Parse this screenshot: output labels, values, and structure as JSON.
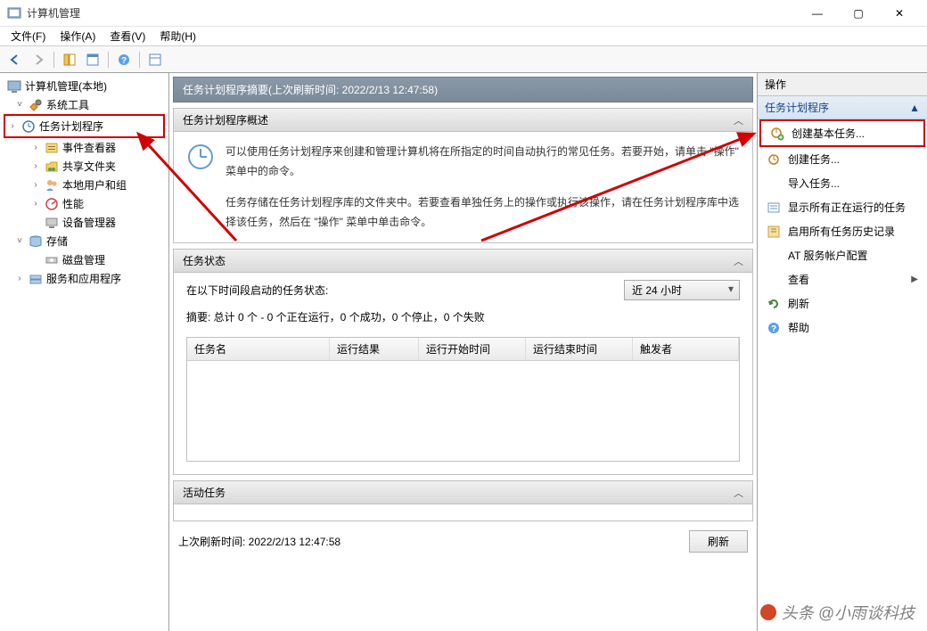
{
  "window": {
    "title": "计算机管理",
    "controls": {
      "min": "—",
      "max": "▢",
      "close": "✕"
    }
  },
  "menu": {
    "file": "文件(F)",
    "action": "操作(A)",
    "view": "查看(V)",
    "help": "帮助(H)"
  },
  "tree": {
    "root": "计算机管理(本地)",
    "system_tools": "系统工具",
    "task_scheduler": "任务计划程序",
    "event_viewer": "事件查看器",
    "shared_folders": "共享文件夹",
    "local_users": "本地用户和组",
    "performance": "性能",
    "device_manager": "设备管理器",
    "storage": "存储",
    "disk_management": "磁盘管理",
    "services_apps": "服务和应用程序"
  },
  "content": {
    "summary_title": "任务计划程序摘要(上次刷新时间: 2022/2/13 12:47:58)",
    "overview_header": "任务计划程序概述",
    "overview_p1": "可以使用任务计划程序来创建和管理计算机将在所指定的时间自动执行的常见任务。若要开始，请单击 \"操作\" 菜单中的命令。",
    "overview_p2": "任务存储在任务计划程序库的文件夹中。若要查看单独任务上的操作或执行该操作，请在任务计划程序库中选择该任务，然后在 \"操作\" 菜单中单击命令。",
    "status_header": "任务状态",
    "status_label": "在以下时间段启动的任务状态:",
    "status_select": "近 24 小时",
    "status_summary": "摘要: 总计 0 个 - 0 个正在运行，0 个成功，0 个停止，0 个失败",
    "columns": {
      "name": "任务名",
      "result": "运行结果",
      "start": "运行开始时间",
      "end": "运行结束时间",
      "trigger": "触发者"
    },
    "active_header": "活动任务",
    "last_refresh": "上次刷新时间: 2022/2/13 12:47:58",
    "refresh_btn": "刷新"
  },
  "actions": {
    "pane_title": "操作",
    "group_title": "任务计划程序",
    "create_basic": "创建基本任务...",
    "create_task": "创建任务...",
    "import_task": "导入任务...",
    "show_running": "显示所有正在运行的任务",
    "enable_history": "启用所有任务历史记录",
    "at_service": "AT 服务帐户配置",
    "view": "查看",
    "refresh": "刷新",
    "help": "帮助"
  },
  "watermark": "头条 @小雨谈科技"
}
